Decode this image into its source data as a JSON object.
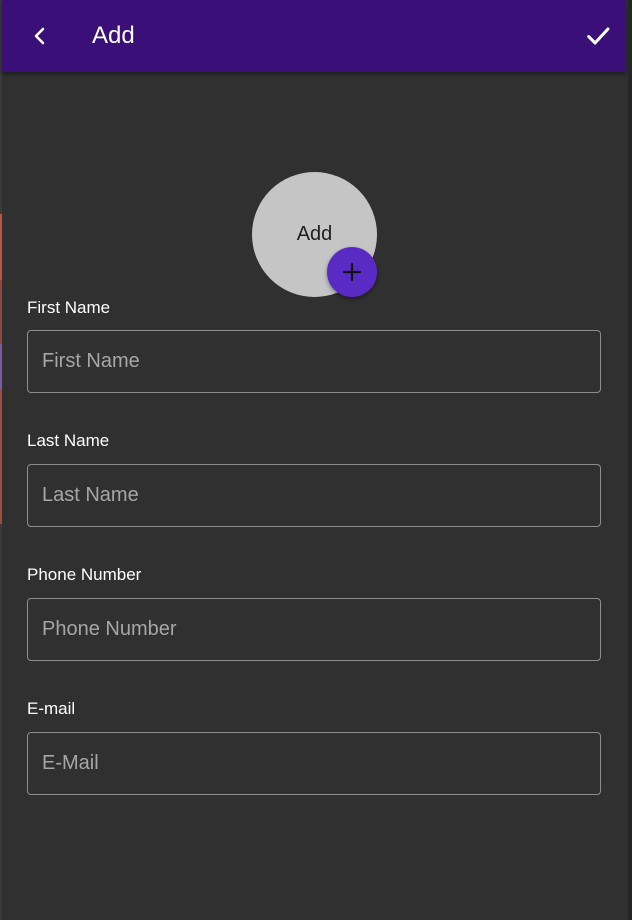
{
  "appbar": {
    "back_icon": "chevron-left-icon",
    "title": "Add",
    "confirm_icon": "check-icon",
    "background": "#3a0f78"
  },
  "avatar": {
    "label": "Add",
    "add_icon": "plus-icon",
    "accent": "#5a2bc4"
  },
  "form": {
    "fields": [
      {
        "label": "First Name",
        "placeholder": "First Name",
        "value": ""
      },
      {
        "label": "Last Name",
        "placeholder": "Last Name",
        "value": ""
      },
      {
        "label": "Phone Number",
        "placeholder": "Phone Number",
        "value": ""
      },
      {
        "label": "E-mail",
        "placeholder": "E-Mail",
        "value": ""
      }
    ]
  }
}
